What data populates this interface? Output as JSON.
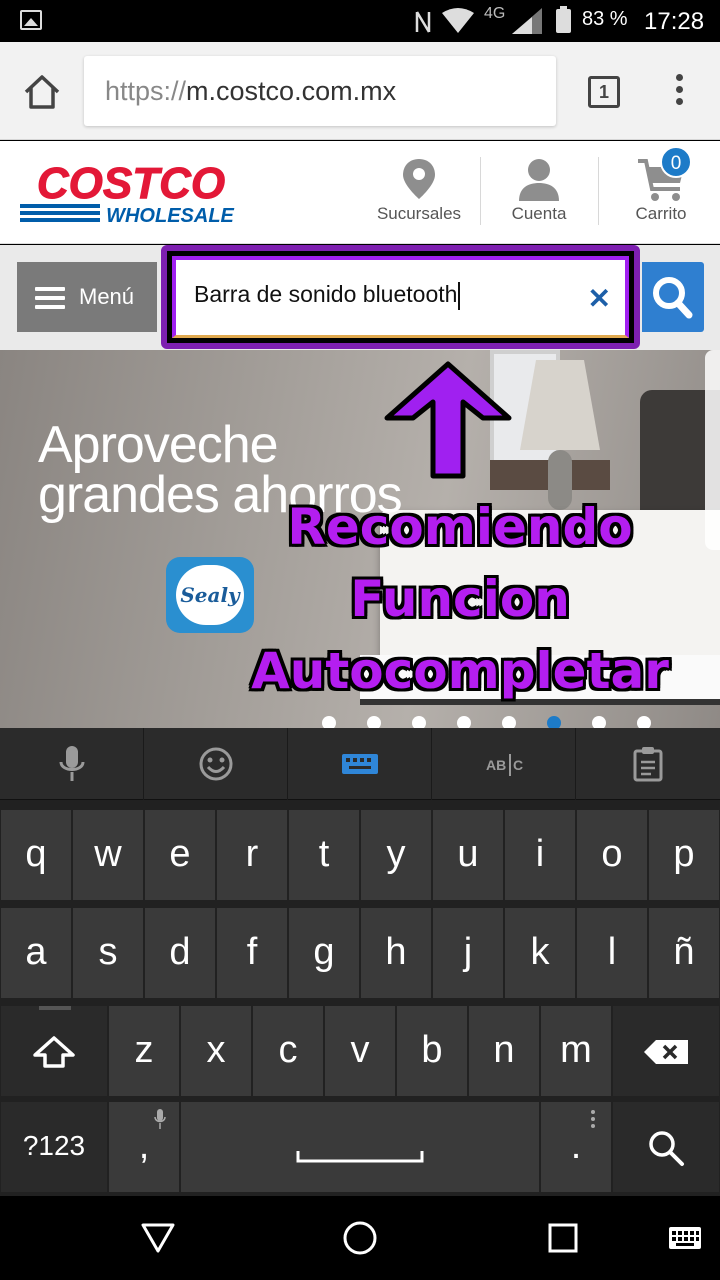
{
  "status_bar": {
    "network": "4G",
    "battery": "83 %",
    "time": "17:28"
  },
  "browser": {
    "url_scheme": "https://",
    "url_host": "m.costco.com.mx",
    "tab_count": "1"
  },
  "site_header": {
    "logo_top": "COSTCO",
    "logo_bottom": "WHOLESALE",
    "nav": [
      {
        "label": "Sucursales",
        "icon": "location-pin-icon"
      },
      {
        "label": "Cuenta",
        "icon": "user-icon"
      },
      {
        "label": "Carrito",
        "icon": "cart-icon"
      }
    ],
    "cart_count": "0"
  },
  "search": {
    "menu_label": "Menú",
    "query": "Barra de sonido bluetooth",
    "clear_symbol": "✕"
  },
  "hero": {
    "title_line1": "Aproveche",
    "title_line2": "grandes ahorros",
    "brand": "Sealy",
    "slides": 9,
    "active_slide": 6
  },
  "annotation": {
    "line1": "Recomiendo",
    "line2": "Funcion",
    "line3": "Autocompletar",
    "color": "#b41ef0"
  },
  "keyboard": {
    "row1": [
      "q",
      "w",
      "e",
      "r",
      "t",
      "y",
      "u",
      "i",
      "o",
      "p"
    ],
    "row2": [
      "a",
      "s",
      "d",
      "f",
      "g",
      "h",
      "j",
      "k",
      "l",
      "ñ"
    ],
    "row3": [
      "z",
      "x",
      "c",
      "v",
      "b",
      "n",
      "m"
    ],
    "symbols_label": "?123",
    "comma": ",",
    "period": "."
  },
  "colors": {
    "costco_red": "#e31837",
    "costco_blue": "#005daa",
    "accent_blue": "#2f7fd0"
  }
}
